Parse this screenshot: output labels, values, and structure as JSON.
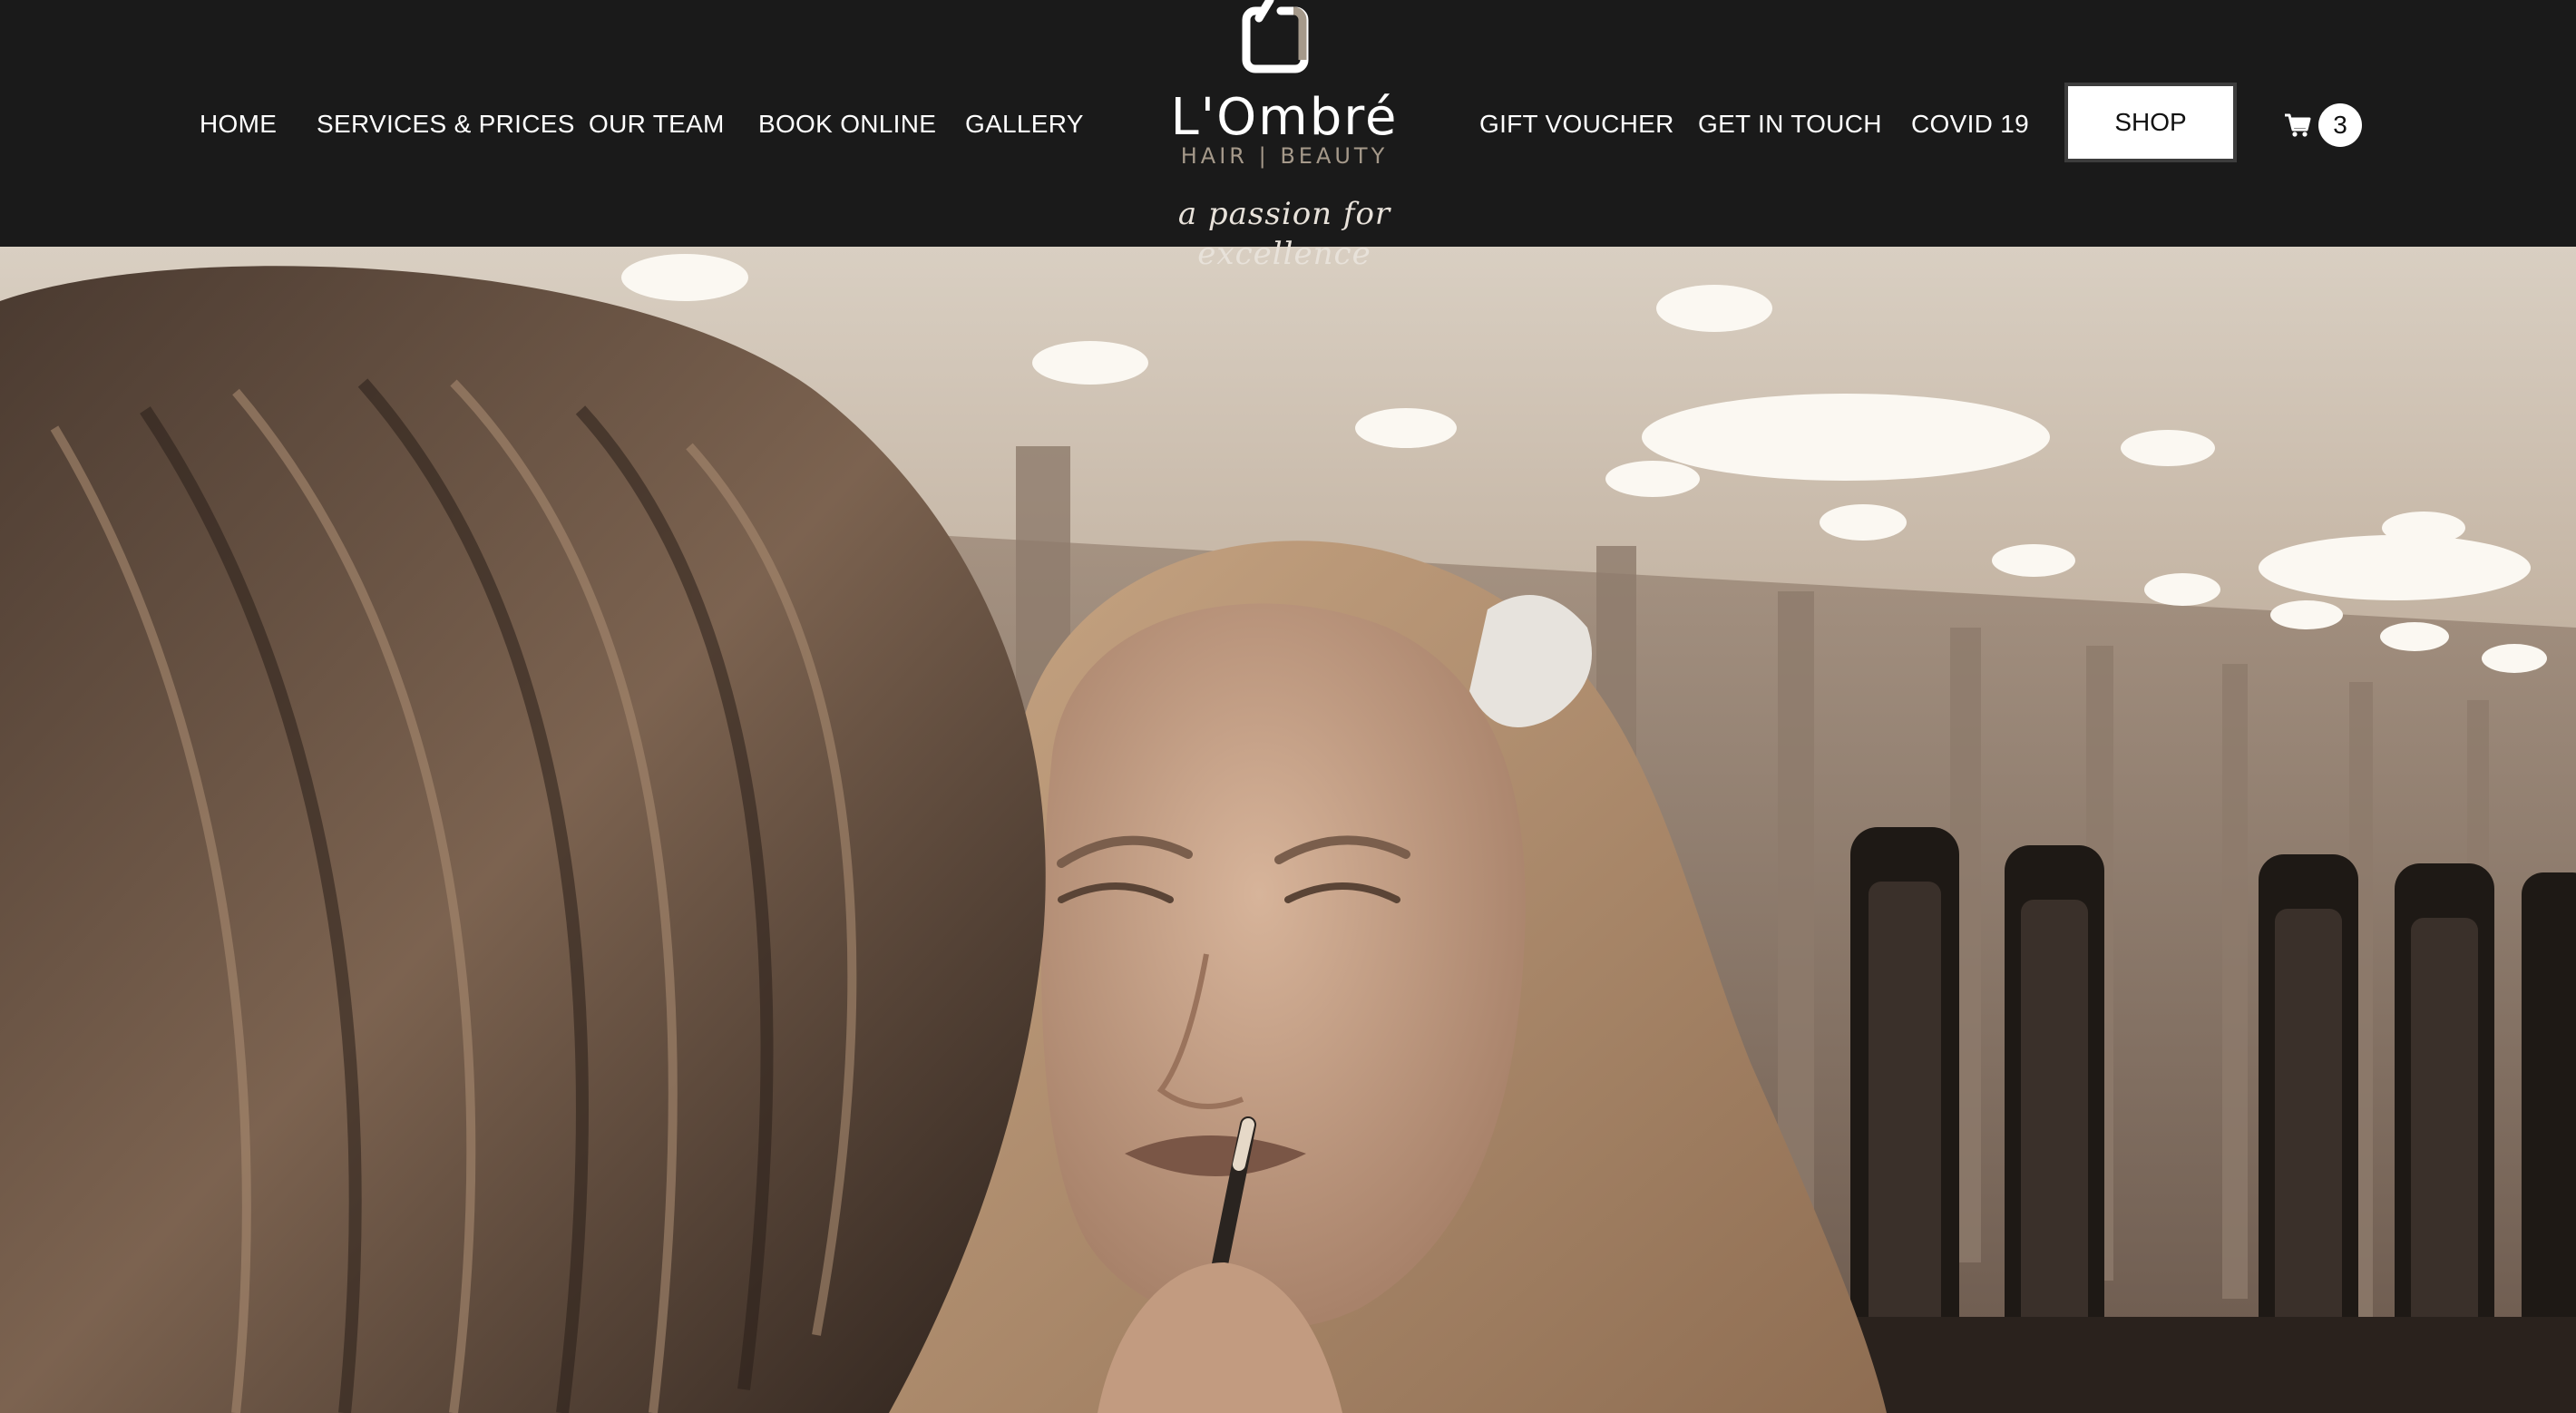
{
  "header": {
    "nav_left": [
      {
        "label": "HOME"
      },
      {
        "label": "SERVICES & PRICES"
      },
      {
        "label": "OUR TEAM"
      },
      {
        "label": "BOOK ONLINE"
      },
      {
        "label": "GALLERY"
      }
    ],
    "nav_right": [
      {
        "label": "GIFT VOUCHER"
      },
      {
        "label": "GET IN TOUCH"
      },
      {
        "label": "COVID 19"
      }
    ],
    "shop_label": "SHOP",
    "cart": {
      "icon": "shopping-cart-icon",
      "count": "3"
    }
  },
  "logo": {
    "wordmark": "L'Ombré",
    "subtitle": "HAIR | BEAUTY",
    "tagline": "a passion for excellence"
  },
  "hero": {
    "icon": "hero-photo",
    "colors": {
      "background": "#1a1a1a",
      "tone": "#8a7566"
    }
  }
}
